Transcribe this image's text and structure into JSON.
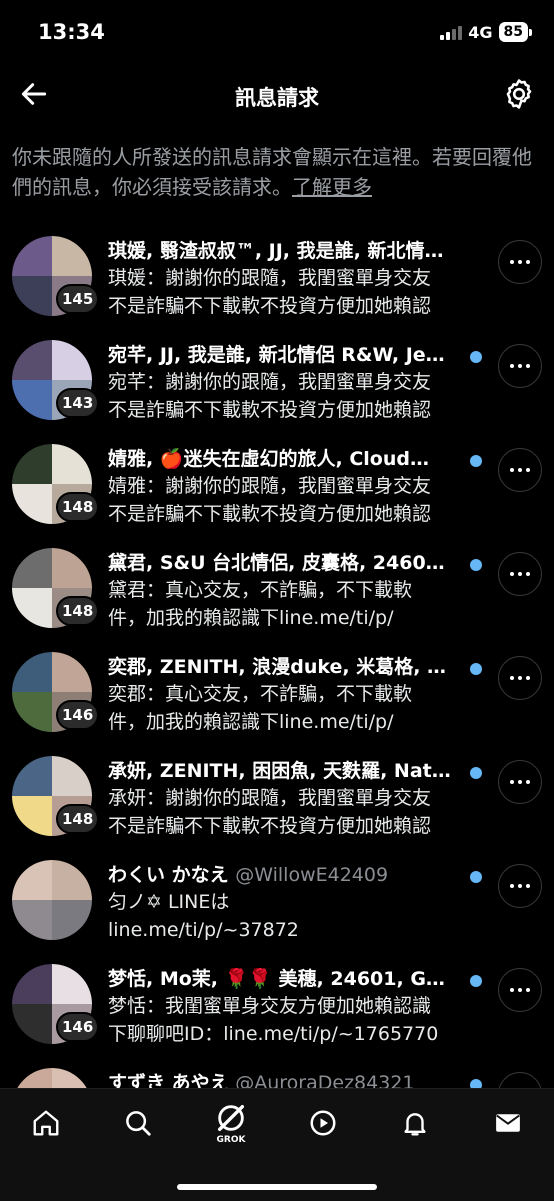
{
  "status": {
    "time": "13:34",
    "network": "4G",
    "battery": "85"
  },
  "header": {
    "title": "訊息請求",
    "back_icon": "arrow-left-icon",
    "settings_icon": "gear-icon"
  },
  "notice": {
    "text": "你未跟隨的人所發送的訊息請求會顯示在這裡。若要回覆他們的訊息，你必須接受該請求。",
    "link": "了解更多"
  },
  "requests": [
    {
      "names": "琪媛, 翳渣叔叔™, JJ, 我是誰, 新北情…",
      "handle": "",
      "line1": "琪媛：謝謝你的跟隨，我閨蜜單身交友",
      "line2": "不是詐騙不下載軟不投資方便加她賴認",
      "badge": "145",
      "unread": false,
      "colors": [
        "#6b5a8a",
        "#c9b7a6",
        "#3c3f57",
        "#8a7a88"
      ]
    },
    {
      "names": "宛芊, JJ, 我是誰, 新北情侶 R&W, Je…",
      "handle": "",
      "line1": "宛芊：謝謝你的跟隨，我閨蜜單身交友",
      "line2": "不是詐騙不下載軟不投資方便加她賴認",
      "badge": "143",
      "unread": true,
      "colors": [
        "#5a4e6e",
        "#d7cfe3",
        "#4d6fb0",
        "#9aa6b8"
      ]
    },
    {
      "names": "婧雅, 🍎迷失在虛幻的旅人, Cloud…",
      "handle": "",
      "line1": "婧雅：謝謝你的跟隨，我閨蜜單身交友",
      "line2": "不是詐騙不下載軟不投資方便加她賴認",
      "badge": "148",
      "unread": true,
      "colors": [
        "#2f3d2c",
        "#e6e1d6",
        "#e8e3dc",
        "#b7a99b"
      ]
    },
    {
      "names": "黛君, S&U 台北情侶, 皮囊格, 2460…",
      "handle": "",
      "line1": "黛君：真心交友，不詐騙，不下載軟",
      "line2": "件，加我的賴認識下line.me/ti/p/",
      "badge": "148",
      "unread": true,
      "colors": [
        "#6d6d6d",
        "#bda394",
        "#e8e6e0",
        "#9b8c86"
      ]
    },
    {
      "names": "奕郡, ZENITH, 浪漫duke, 米葛格, …",
      "handle": "",
      "line1": "奕郡：真心交友，不詐騙，不下載軟",
      "line2": "件，加我的賴認識下line.me/ti/p/",
      "badge": "146",
      "unread": true,
      "colors": [
        "#3e5d7a",
        "#c1a596",
        "#4e6b3e",
        "#8e7f76"
      ]
    },
    {
      "names": "承妍, ZENITH, 困困魚, 天麩羅, Nat…",
      "handle": "",
      "line1": "承妍：謝謝你的跟隨，我閨蜜單身交友",
      "line2": "不是詐騙不下載軟不投資方便加她賴認",
      "badge": "148",
      "unread": true,
      "colors": [
        "#4a6585",
        "#d8cfc8",
        "#f1d98a",
        "#b79e94"
      ]
    },
    {
      "names": "わくい かなえ",
      "handle": "@WillowE42409",
      "line1": "匀ノ✡ LINEは",
      "line2": "line.me/ti/p/~37872",
      "badge": "",
      "unread": true,
      "colors": [
        "#d8c3b6",
        "#c7b1a3",
        "#8e8a8f",
        "#7b7a80"
      ]
    },
    {
      "names": "梦恬, Mo茉, 🌹🌹 美穗, 24601, G…",
      "handle": "",
      "line1": "梦恬：我閨蜜單身交友方便加她賴認識",
      "line2": "下聊聊吧ID：line.me/ti/p/~1765770",
      "badge": "146",
      "unread": true,
      "colors": [
        "#4b3d5c",
        "#e7dfe4",
        "#2e2e2e",
        "#a89aa0"
      ]
    },
    {
      "names": "すずき あやえ",
      "handle": "@AuroraDez84321",
      "line1": "",
      "line2": "",
      "badge": "",
      "unread": true,
      "colors": [
        "#caa99a",
        "#d9bfb2",
        "#b89688",
        "#c4a395"
      ]
    }
  ],
  "tabs": [
    {
      "name": "tab-home",
      "icon": "home-icon"
    },
    {
      "name": "tab-search",
      "icon": "search-icon"
    },
    {
      "name": "tab-grok",
      "icon": "grok-icon",
      "label": "GROK"
    },
    {
      "name": "tab-media",
      "icon": "play-icon"
    },
    {
      "name": "tab-notifications",
      "icon": "bell-icon"
    },
    {
      "name": "tab-messages",
      "icon": "mail-icon"
    }
  ]
}
